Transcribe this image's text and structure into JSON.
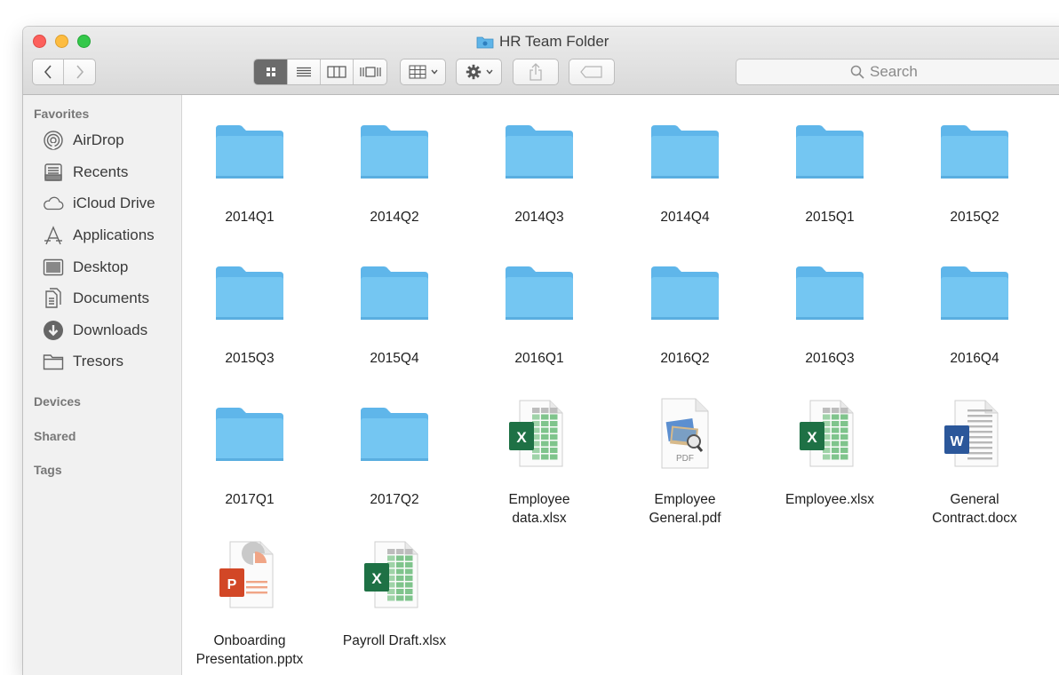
{
  "window": {
    "title": "HR Team Folder"
  },
  "toolbar": {
    "search_placeholder": "Search"
  },
  "sidebar": {
    "favorites_header": "Favorites",
    "favorites": [
      {
        "label": "AirDrop",
        "icon": "airdrop-icon"
      },
      {
        "label": "Recents",
        "icon": "recents-icon"
      },
      {
        "label": "iCloud Drive",
        "icon": "cloud-icon"
      },
      {
        "label": "Applications",
        "icon": "applications-icon"
      },
      {
        "label": "Desktop",
        "icon": "desktop-icon"
      },
      {
        "label": "Documents",
        "icon": "documents-icon"
      },
      {
        "label": "Downloads",
        "icon": "downloads-icon"
      },
      {
        "label": "Tresors",
        "icon": "folder-icon"
      }
    ],
    "devices_header": "Devices",
    "shared_header": "Shared",
    "tags_header": "Tags"
  },
  "files": [
    {
      "name": "2014Q1",
      "kind": "folder"
    },
    {
      "name": "2014Q2",
      "kind": "folder"
    },
    {
      "name": "2014Q3",
      "kind": "folder"
    },
    {
      "name": "2014Q4",
      "kind": "folder"
    },
    {
      "name": "2015Q1",
      "kind": "folder"
    },
    {
      "name": "2015Q2",
      "kind": "folder"
    },
    {
      "name": "2015Q3",
      "kind": "folder"
    },
    {
      "name": "2015Q4",
      "kind": "folder"
    },
    {
      "name": "2016Q1",
      "kind": "folder"
    },
    {
      "name": "2016Q2",
      "kind": "folder"
    },
    {
      "name": "2016Q3",
      "kind": "folder"
    },
    {
      "name": "2016Q4",
      "kind": "folder"
    },
    {
      "name": "2017Q1",
      "kind": "folder"
    },
    {
      "name": "2017Q2",
      "kind": "folder"
    },
    {
      "name": "Employee data.xlsx",
      "kind": "xlsx",
      "name_lines": [
        "Employee",
        "data.xlsx"
      ]
    },
    {
      "name": "Employee General.pdf",
      "kind": "pdf",
      "name_lines": [
        "Employee",
        "General.pdf"
      ],
      "badge": "PDF"
    },
    {
      "name": "Employee.xlsx",
      "kind": "xlsx",
      "name_lines": [
        "Employee.xlsx"
      ]
    },
    {
      "name": "General Contract.docx",
      "kind": "docx",
      "name_lines": [
        "General",
        "Contract.docx"
      ]
    },
    {
      "name": "Onboarding Presentation.pptx",
      "kind": "pptx",
      "name_lines": [
        "Onboarding",
        "Presentation.pptx"
      ]
    },
    {
      "name": "Payroll Draft.xlsx",
      "kind": "xlsx",
      "name_lines": [
        "Payroll Draft.xlsx"
      ]
    }
  ],
  "colors": {
    "folder": "#74c6f2",
    "excel": "#1e7145",
    "word": "#2b579a",
    "powerpoint": "#d24726",
    "view_active": "#6b6b6b"
  }
}
